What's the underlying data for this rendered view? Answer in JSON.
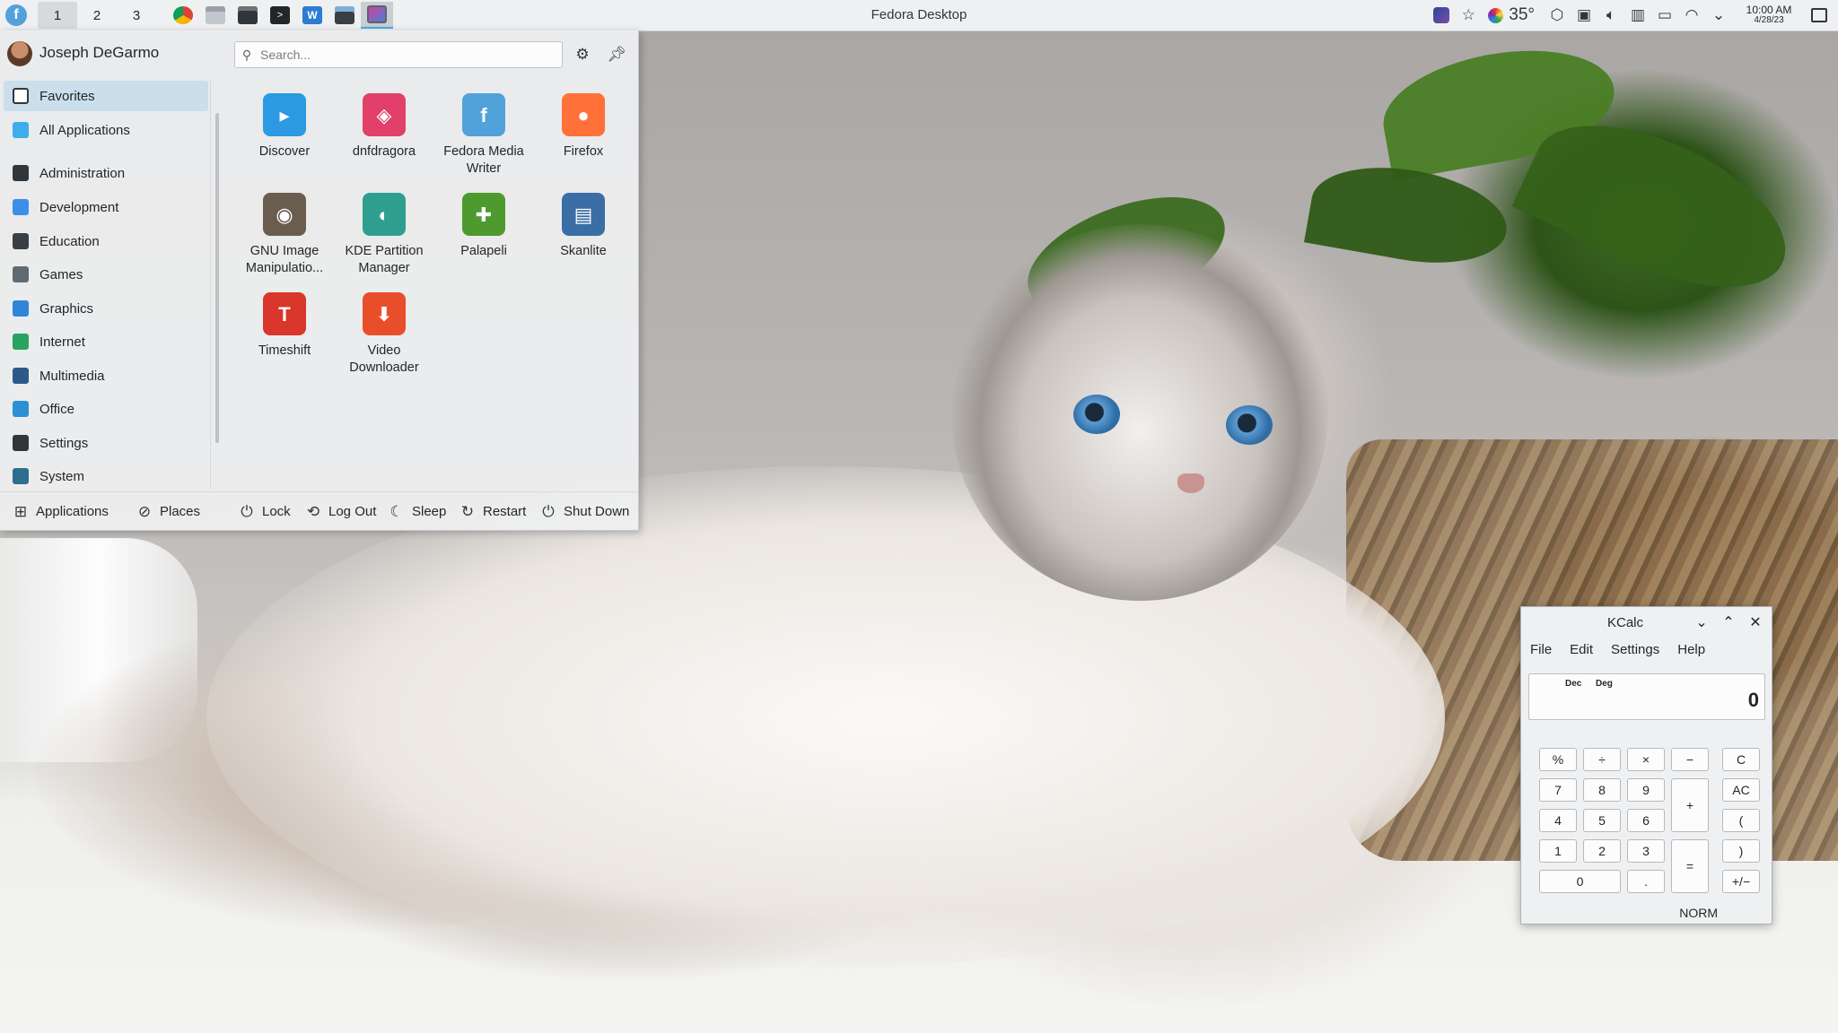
{
  "panel": {
    "title": "Fedora Desktop",
    "pager": [
      "1",
      "2",
      "3"
    ],
    "current_desktop": 1,
    "tray": {
      "temperature": "35°",
      "clock_time": "10:00 AM",
      "clock_date": "4/28/23"
    }
  },
  "launcher": {
    "username": "Joseph DeGarmo",
    "search_placeholder": "Search...",
    "categories": [
      {
        "label": "Favorites",
        "icon": "bookmark-icon",
        "color": "#ffffff"
      },
      {
        "label": "All Applications",
        "icon": "grid-icon",
        "color": "#3daee9"
      },
      {
        "label": "Administration",
        "icon": "admin-icon",
        "color": "#31363b"
      },
      {
        "label": "Development",
        "icon": "development-icon",
        "color": "#3d8ee9"
      },
      {
        "label": "Education",
        "icon": "education-icon",
        "color": "#3a3f44"
      },
      {
        "label": "Games",
        "icon": "gamepad-icon",
        "color": "#5f6a73"
      },
      {
        "label": "Graphics",
        "icon": "graphics-icon",
        "color": "#2f86d8"
      },
      {
        "label": "Internet",
        "icon": "globe-icon",
        "color": "#27a45f"
      },
      {
        "label": "Multimedia",
        "icon": "multimedia-icon",
        "color": "#2b5a8a"
      },
      {
        "label": "Office",
        "icon": "office-icon",
        "color": "#2d8fd5"
      },
      {
        "label": "Settings",
        "icon": "settings-icon",
        "color": "#31363b"
      },
      {
        "label": "System",
        "icon": "system-icon",
        "color": "#2a6f8f"
      }
    ],
    "apps": [
      {
        "label": "Discover",
        "icon": "discover-icon",
        "color": "#2b9ae2",
        "glyph": "▸"
      },
      {
        "label": "dnfdragora",
        "icon": "dnfdragora-icon",
        "color": "#e0406a",
        "glyph": "◈"
      },
      {
        "label": "Fedora Media Writer",
        "icon": "fedora-media-writer-icon",
        "color": "#51a2da",
        "glyph": "f"
      },
      {
        "label": "Firefox",
        "icon": "firefox-icon",
        "color": "#ff7139",
        "glyph": "●"
      },
      {
        "label": "GNU Image Manipulatio...",
        "icon": "gimp-icon",
        "color": "#6a5d4d",
        "glyph": "◉"
      },
      {
        "label": "KDE Partition Manager",
        "icon": "partition-manager-icon",
        "color": "#2e9f8e",
        "glyph": "◐"
      },
      {
        "label": "Palapeli",
        "icon": "palapeli-icon",
        "color": "#4e9a2e",
        "glyph": "✚"
      },
      {
        "label": "Skanlite",
        "icon": "skanlite-icon",
        "color": "#3a6ea5",
        "glyph": "▤"
      },
      {
        "label": "Timeshift",
        "icon": "timeshift-icon",
        "color": "#d9372b",
        "glyph": "T"
      },
      {
        "label": "Video Downloader",
        "icon": "video-downloader-icon",
        "color": "#e94e2b",
        "glyph": "⬇"
      }
    ],
    "footer": {
      "applications": "Applications",
      "places": "Places",
      "lock": "Lock",
      "logout": "Log Out",
      "sleep": "Sleep",
      "restart": "Restart",
      "shutdown": "Shut Down"
    }
  },
  "kcalc": {
    "title": "KCalc",
    "menu": [
      "File",
      "Edit",
      "Settings",
      "Help"
    ],
    "mode_base": "Dec",
    "mode_angle": "Deg",
    "display_value": "0",
    "status": "NORM",
    "buttons": {
      "percent": "%",
      "divide": "÷",
      "multiply": "×",
      "minus": "−",
      "clear": "C",
      "seven": "7",
      "eight": "8",
      "nine": "9",
      "plus": "+",
      "all_clear": "AC",
      "four": "4",
      "five": "5",
      "six": "6",
      "open_paren": "(",
      "one": "1",
      "two": "2",
      "three": "3",
      "equals": "=",
      "close_paren": ")",
      "zero": "0",
      "decimal": ".",
      "sign": "+/−"
    }
  },
  "colors": {
    "accent": "#3daee9",
    "panel_bg": "#eff0f1"
  }
}
